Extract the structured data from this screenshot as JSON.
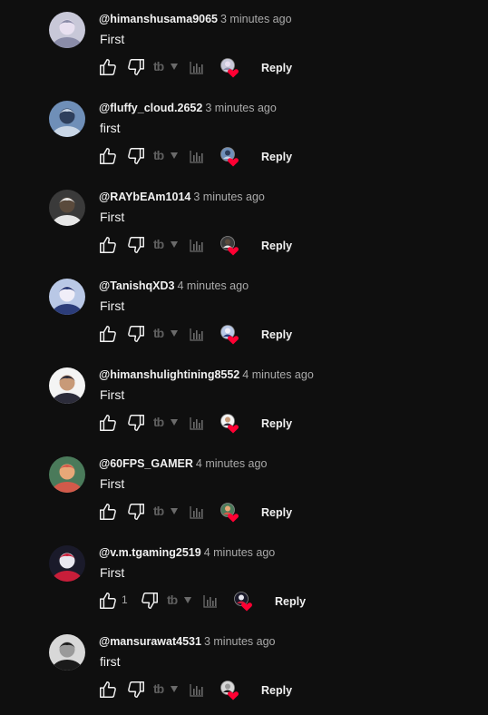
{
  "comments": [
    {
      "handle": "@himanshusama9065",
      "time": "3 minutes ago",
      "text": "First",
      "likes": "",
      "avatar": "anime-girl-avatar",
      "colors": [
        "#c8c8d8",
        "#8a8ca8",
        "#e8e0f0"
      ]
    },
    {
      "handle": "@fluffy_cloud.2652",
      "time": "3 minutes ago",
      "text": "first",
      "likes": "",
      "avatar": "airplane-sky-avatar",
      "colors": [
        "#6f8fb8",
        "#c9d6e6",
        "#2e3f5c"
      ]
    },
    {
      "handle": "@RAYbEAm1014",
      "time": "3 minutes ago",
      "text": "First",
      "likes": "",
      "avatar": "person-avatar",
      "colors": [
        "#3a3a3a",
        "#e6e6e6",
        "#5a4a3c"
      ]
    },
    {
      "handle": "@TanishqXD3",
      "time": "4 minutes ago",
      "text": "First",
      "likes": "",
      "avatar": "anime-character-avatar",
      "colors": [
        "#b9c8e6",
        "#2c3d7a",
        "#f0eef8"
      ]
    },
    {
      "handle": "@himanshulightining8552",
      "time": "4 minutes ago",
      "text": "First",
      "likes": "",
      "avatar": "person-avatar",
      "colors": [
        "#f4f4f4",
        "#2c2c3a",
        "#c89a78"
      ]
    },
    {
      "handle": "@60FPS_GAMER",
      "time": "4 minutes ago",
      "text": "First",
      "likes": "",
      "avatar": "game-character-avatar",
      "colors": [
        "#4a7a5a",
        "#d25a4a",
        "#e8a878"
      ]
    },
    {
      "handle": "@v.m.tgaming2519",
      "time": "4 minutes ago",
      "text": "First",
      "likes": "1",
      "avatar": "gaming-logo-avatar",
      "colors": [
        "#1a1a2a",
        "#c81e3a",
        "#e8e8f0"
      ]
    },
    {
      "handle": "@mansurawat4531",
      "time": "3 minutes ago",
      "text": "first",
      "likes": "",
      "avatar": "dark-hair-avatar",
      "colors": [
        "#d8d8d8",
        "#1a1a1a",
        "#9a9a9a"
      ]
    }
  ],
  "labels": {
    "reply": "Reply",
    "translate": "tb"
  },
  "icons": {
    "like": "thumbs-up-icon",
    "dislike": "thumbs-down-icon",
    "translate": "translate-icon",
    "dropdown": "dropdown-triangle-icon",
    "stats": "bar-chart-icon",
    "creator_heart": "creator-heart-icon"
  },
  "theme": {
    "background": "#0f0f0f",
    "text": "#f1f1f1",
    "secondary_text": "#aaaaaa",
    "heart": "#ff0033"
  }
}
